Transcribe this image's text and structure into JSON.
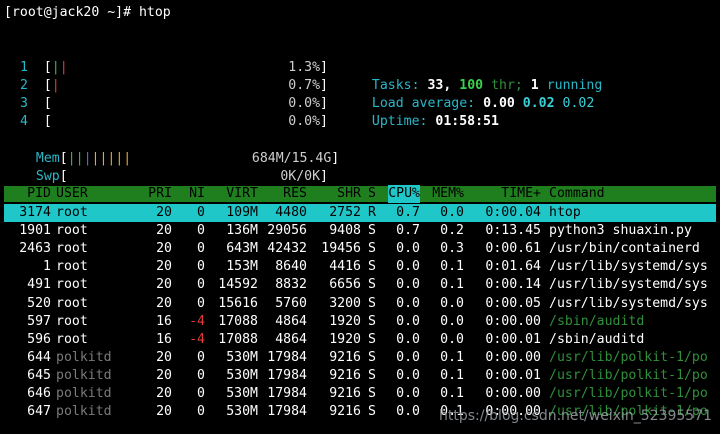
{
  "prompt": "[root@jack20 ~]# htop",
  "cpus": [
    {
      "label": "1",
      "bar_red": "|",
      "bar_green": "|",
      "bar_blue": "",
      "percent": "1.3%"
    },
    {
      "label": "2",
      "bar_red": "|",
      "bar_green": "",
      "bar_blue": "",
      "percent": "0.7%"
    },
    {
      "label": "3",
      "bar_red": "",
      "bar_green": "",
      "bar_blue": "",
      "percent": "0.0%"
    },
    {
      "label": "4",
      "bar_red": "",
      "bar_green": "",
      "bar_blue": "",
      "percent": "0.0%"
    }
  ],
  "mem": {
    "label": "Mem",
    "value": "684M/15.4G"
  },
  "swp": {
    "label": "Swp",
    "value": "0K/0K"
  },
  "summary": {
    "tasks_label": "Tasks:",
    "tasks": "33",
    "thr": "100",
    "thr_label": "thr;",
    "running": "1",
    "running_label": "running",
    "load_label": "Load average:",
    "load1": "0.00",
    "load5": "0.02",
    "load15": "0.02",
    "uptime_label": "Uptime:",
    "uptime": "01:58:51"
  },
  "columns": [
    "PID",
    "USER",
    "PRI",
    "NI",
    "VIRT",
    "RES",
    "SHR",
    "S",
    "CPU%",
    "MEM%",
    "TIME+",
    "Command"
  ],
  "processes": [
    {
      "pid": "3174",
      "user": "root",
      "pri": "20",
      "ni": "0",
      "virt": "109M",
      "res": "4480",
      "shr": "2752",
      "s": "R",
      "cpu": "0.7",
      "mem": "0.0",
      "time": "0:00.04",
      "cmd": "htop",
      "selected": true
    },
    {
      "pid": "1901",
      "user": "root",
      "pri": "20",
      "ni": "0",
      "virt": "136M",
      "res": "29056",
      "shr": "9408",
      "s": "S",
      "cpu": "0.7",
      "mem": "0.2",
      "time": "0:13.45",
      "cmd": "python3 shuaxin.py"
    },
    {
      "pid": "2463",
      "user": "root",
      "pri": "20",
      "ni": "0",
      "virt": "643M",
      "res": "42432",
      "shr": "19456",
      "s": "S",
      "cpu": "0.0",
      "mem": "0.3",
      "time": "0:00.61",
      "cmd": "/usr/bin/containerd"
    },
    {
      "pid": "1",
      "user": "root",
      "pri": "20",
      "ni": "0",
      "virt": "153M",
      "res": "8640",
      "shr": "4416",
      "s": "S",
      "cpu": "0.0",
      "mem": "0.1",
      "time": "0:01.64",
      "cmd": "/usr/lib/systemd/sys"
    },
    {
      "pid": "491",
      "user": "root",
      "pri": "20",
      "ni": "0",
      "virt": "14592",
      "res": "8832",
      "shr": "6656",
      "s": "S",
      "cpu": "0.0",
      "mem": "0.1",
      "time": "0:00.14",
      "cmd": "/usr/lib/systemd/sys"
    },
    {
      "pid": "520",
      "user": "root",
      "pri": "20",
      "ni": "0",
      "virt": "15616",
      "res": "5760",
      "shr": "3200",
      "s": "S",
      "cpu": "0.0",
      "mem": "0.0",
      "time": "0:00.05",
      "cmd": "/usr/lib/systemd/sys"
    },
    {
      "pid": "597",
      "user": "root",
      "pri": "16",
      "ni": "-4",
      "virt": "17088",
      "res": "4864",
      "shr": "1920",
      "s": "S",
      "cpu": "0.0",
      "mem": "0.0",
      "time": "0:00.00",
      "cmd": "/sbin/auditd",
      "cmd_style": "green"
    },
    {
      "pid": "596",
      "user": "root",
      "pri": "16",
      "ni": "-4",
      "virt": "17088",
      "res": "4864",
      "shr": "1920",
      "s": "S",
      "cpu": "0.0",
      "mem": "0.0",
      "time": "0:00.01",
      "cmd": "/sbin/auditd"
    },
    {
      "pid": "644",
      "user": "polkitd",
      "pri": "20",
      "ni": "0",
      "virt": "530M",
      "res": "17984",
      "shr": "9216",
      "s": "S",
      "cpu": "0.0",
      "mem": "0.1",
      "time": "0:00.00",
      "cmd": "/usr/lib/polkit-1/po",
      "cmd_style": "green",
      "user_style": "dim"
    },
    {
      "pid": "645",
      "user": "polkitd",
      "pri": "20",
      "ni": "0",
      "virt": "530M",
      "res": "17984",
      "shr": "9216",
      "s": "S",
      "cpu": "0.0",
      "mem": "0.1",
      "time": "0:00.01",
      "cmd": "/usr/lib/polkit-1/po",
      "cmd_style": "green",
      "user_style": "dim"
    },
    {
      "pid": "646",
      "user": "polkitd",
      "pri": "20",
      "ni": "0",
      "virt": "530M",
      "res": "17984",
      "shr": "9216",
      "s": "S",
      "cpu": "0.0",
      "mem": "0.1",
      "time": "0:00.00",
      "cmd": "/usr/lib/polkit-1/po",
      "cmd_style": "green",
      "user_style": "dim"
    },
    {
      "pid": "647",
      "user": "polkitd",
      "pri": "20",
      "ni": "0",
      "virt": "530M",
      "res": "17984",
      "shr": "9216",
      "s": "S",
      "cpu": "0.0",
      "mem": "0.1",
      "time": "0:00.00",
      "cmd": "/usr/lib/polkit-1/po",
      "cmd_style": "green",
      "user_style": "dim"
    }
  ],
  "watermark": "https://blog.csdn.net/weixin_52395571"
}
